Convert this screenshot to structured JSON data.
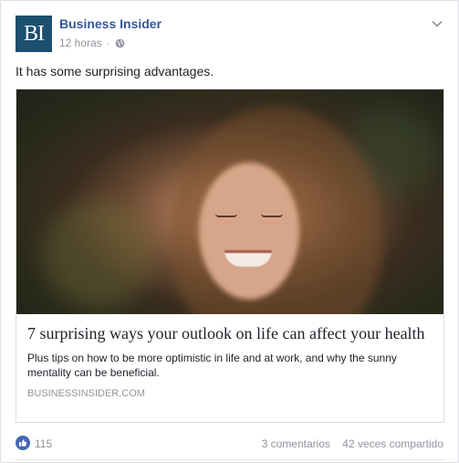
{
  "post": {
    "page_name": "Business Insider",
    "avatar_text": "BI",
    "time": "12 horas",
    "separator": "·",
    "message": "It has some surprising advantages."
  },
  "link": {
    "title": "7 surprising ways your outlook on life can affect your health",
    "description": "Plus tips on how to be more optimistic in life and at work, and why the sunny mentality can be beneficial.",
    "domain": "BUSINESSINSIDER.COM"
  },
  "footer": {
    "likes": "115",
    "comments": "3 comentarios",
    "shares": "42 veces compartido"
  },
  "colors": {
    "brand": "#365899",
    "avatar_bg": "#1d4f6e",
    "like_blue": "#4267b2",
    "muted": "#90949c"
  },
  "icons": {
    "privacy": "globe-icon",
    "menu": "chevron-down-icon",
    "reaction": "like-icon"
  }
}
